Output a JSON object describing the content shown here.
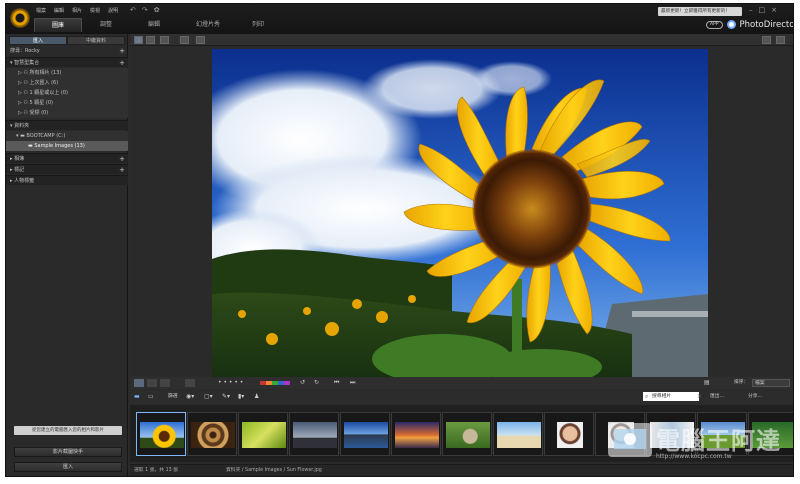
{
  "menu": [
    "檔案",
    "編輯",
    "相片",
    "檢視",
    "說明"
  ],
  "modes": [
    {
      "label": "圖庫",
      "active": true
    },
    {
      "label": "調整",
      "active": false
    },
    {
      "label": "編輯",
      "active": false
    },
    {
      "label": "幻燈片秀",
      "active": false
    },
    {
      "label": "列印",
      "active": false
    }
  ],
  "update_notice": "最新更新！立即獲得所有更新的！",
  "brand": {
    "badge": "APP",
    "name": "PhotoDirector"
  },
  "left_panel": {
    "tabs": [
      "匯入",
      "中繼資料"
    ],
    "search_label": "搜尋：Rocky",
    "smart_collections": {
      "title": "智慧型集合",
      "items": [
        "所有相片 (13)",
        "上次匯入 (6)",
        "1 顆星或以上 (0)",
        "5 顆星 (0)",
        "受標 (0)"
      ]
    },
    "folders": {
      "title": "資料夾",
      "drive": "BOOTCAMP (C:)",
      "folder": "Sample Images (13)"
    },
    "albums": "相簿",
    "tags": "標記",
    "people": "人物標籤",
    "tip": "從您建立的電腦匯入您的相片和影片",
    "buttons": [
      "影片截圖快手",
      "匯入"
    ]
  },
  "filmstrip_bar": {
    "filter": "篩選",
    "search_placeholder": "搜尋相片",
    "export": "匯出...",
    "share": "分享...",
    "sort_label": "排序：",
    "sort_value": "檔案"
  },
  "status": {
    "selection": "選取 1 張，共 13 張",
    "path": "資料夾 / Sample Images / Sun Flower.jpg"
  },
  "watermark_text": "電腦王阿達",
  "watermark_url": "http://www.kocpc.com.tw",
  "colors": {
    "accent": "#7ab8ff",
    "panel": "#2a2a2a",
    "titlebar": "#1a1a1a"
  },
  "thumbnail_count": 13,
  "selected_thumbnail": "Sun Flower.jpg"
}
